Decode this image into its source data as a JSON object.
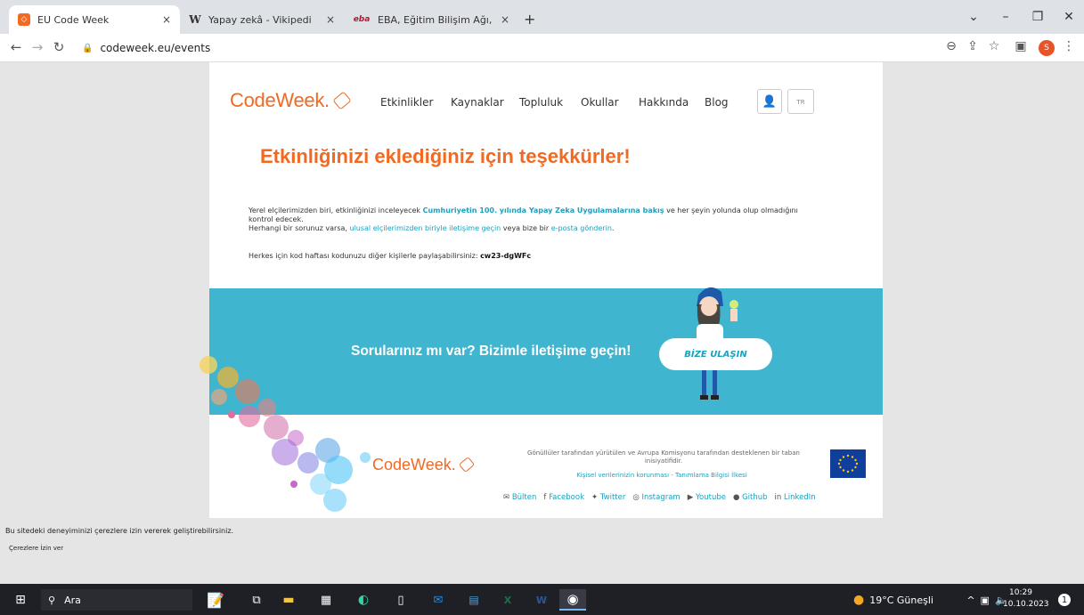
{
  "browser": {
    "tabs": [
      {
        "favicon": "codeweek-icon",
        "label": "EU Code Week",
        "close": "×"
      },
      {
        "favicon": "wikipedia-icon",
        "label": "Yapay zekâ - Vikipedi",
        "close": "×"
      },
      {
        "favicon": "eba-icon",
        "label": "EBA, Eğitim Bilişim Ağı, Ders, Ha",
        "close": "×"
      }
    ],
    "new_tab": "+",
    "url": "codeweek.eu/events",
    "window_controls": {
      "minimize": "–",
      "restore": "❐",
      "close": "✕",
      "tabsearch": "⌄"
    }
  },
  "site": {
    "logo": "CodeWeek.",
    "nav": [
      "Etkinlikler",
      "Kaynaklar",
      "Topluluk",
      "Okullar",
      "Hakkında",
      "Blog"
    ],
    "lang": "TR"
  },
  "content": {
    "heading": "Etkinliğinizi eklediğiniz için teşekkürler!",
    "p1_before": "Yerel elçilerimizden biri, etkinliğinizi inceleyecek ",
    "p1_event": "Cumhuriyetin 100. yılında Yapay Zeka Uygulamalarına bakış",
    "p1_after": " ve her şeyin yolunda olup olmadığını kontrol edecek.",
    "p2_before": "Herhangi bir sorunuz varsa, ",
    "p2_link1": "ulusal elçilerimizden biriyle iletişime geçin",
    "p2_mid": " veya bize bir ",
    "p2_link2": "e-posta gönderin",
    "p2_after": ".",
    "p3": "Herkes için kod haftası kodunuzu diğer kişilerle paylaşabilirsiniz: ",
    "code": "cw23-dgWFc"
  },
  "banner": {
    "text": "Sorularınız mı var? Bizimle iletişime geçin!",
    "button": "BİZE ULAŞIN"
  },
  "footer": {
    "logo": "CodeWeek.",
    "text": "Gönüllüler tarafından yürütülen ve Avrupa Komisyonu tarafından desteklenen bir taban inisiyatifidir.",
    "links": "Kişisel verilerinizin korunması - Tanımlama Bilgisi İlkesi",
    "social": [
      "Bülten",
      "Facebook",
      "Twitter",
      "Instagram",
      "Youtube",
      "Github",
      "LinkedIn"
    ]
  },
  "cookie": {
    "text": "Bu sitedeki deneyiminizi çerezlere izin vererek geliştirebilirsiniz.",
    "button": "Çerezlere İzin ver"
  },
  "taskbar": {
    "search": "Ara",
    "weather": "19°C Güneşli",
    "time": "10:29",
    "date": "10.10.2023",
    "notifications": "1"
  }
}
